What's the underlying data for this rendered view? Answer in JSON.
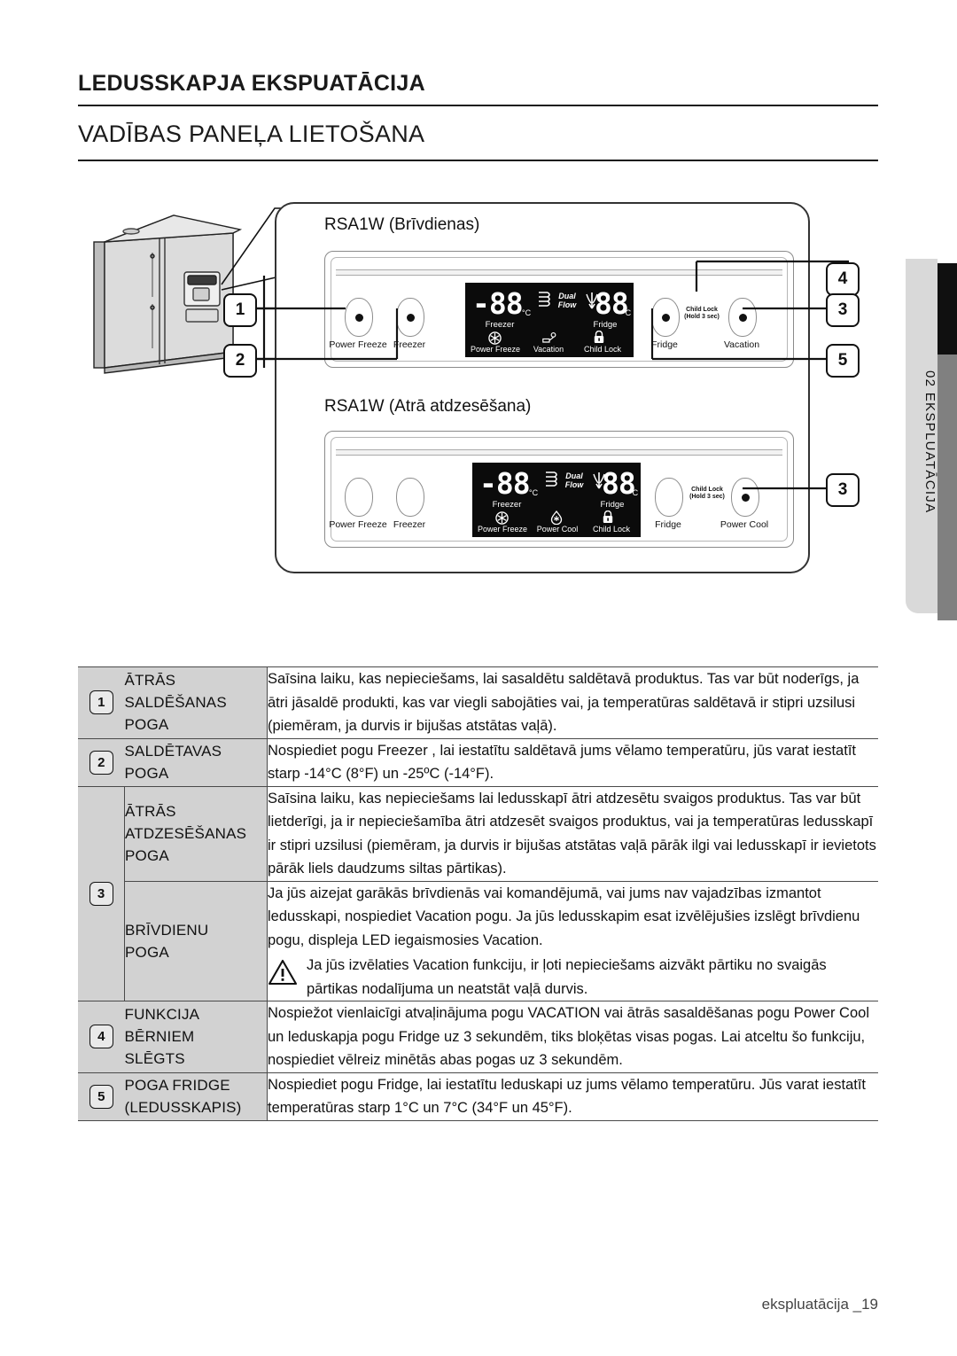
{
  "headings": {
    "title": "LEDUSSKAPJA EKSPUATĀCIJA",
    "subtitle": "VADĪBAS PANEĻA LIETOŠANA"
  },
  "side_tab": {
    "label": "02 EKSPLUATĀCIJA"
  },
  "footer": {
    "text": "ekspluatācija _19"
  },
  "diagram": {
    "panels": [
      {
        "caption": "RSA1W (Brīvdienas)",
        "buttons_left": [
          {
            "label": "Power Freeze",
            "has_dot": true
          },
          {
            "label": "Freezer",
            "has_dot": true
          }
        ],
        "buttons_right": [
          {
            "label": "Fridge",
            "has_dot": true
          },
          {
            "label": "Vacation",
            "has_dot": true
          }
        ],
        "child_lock_hint": {
          "line1": "Child Lock",
          "line2": "(Hold 3 sec)"
        },
        "display": {
          "left_value": "-88",
          "left_unit": "°C",
          "left_label": "Freezer",
          "right_value": "88",
          "right_unit": "°C",
          "right_label": "Fridge",
          "center_badge_line1": "Dual",
          "center_badge_line2": "Flow",
          "indicators": [
            {
              "icon": "snowflake-icon",
              "label": "Power Freeze"
            },
            {
              "icon": "vacation-icon",
              "label": "Vacation"
            },
            {
              "icon": "lock-icon",
              "label": "Child Lock"
            }
          ]
        }
      },
      {
        "caption": "RSA1W (Atrā atdzesēšana)",
        "buttons_left": [
          {
            "label": "Power Freeze",
            "has_dot": false
          },
          {
            "label": "Freezer",
            "has_dot": false
          }
        ],
        "buttons_right": [
          {
            "label": "Fridge",
            "has_dot": false
          },
          {
            "label": "Power Cool",
            "has_dot": true
          }
        ],
        "child_lock_hint": {
          "line1": "Child Lock",
          "line2": "(Hold 3 sec)"
        },
        "display": {
          "left_value": "-88",
          "left_unit": "°C",
          "left_label": "Freezer",
          "right_value": "88",
          "right_unit": "°C",
          "right_label": "Fridge",
          "center_badge_line1": "Dual",
          "center_badge_line2": "Flow",
          "indicators": [
            {
              "icon": "snowflake-icon",
              "label": "Power Freeze"
            },
            {
              "icon": "droplet-icon",
              "label": "Power Cool"
            },
            {
              "icon": "lock-icon",
              "label": "Child Lock"
            }
          ]
        }
      }
    ],
    "callouts": [
      "1",
      "2",
      "4",
      "3",
      "5",
      "3"
    ]
  },
  "table": {
    "rows": [
      {
        "number": "1",
        "name": "ĀTRĀS\nSALDĒŠANAS\nPOGA",
        "desc": "Saīsina laiku, kas nepieciešams, lai sasaldētu saldētavā produktus. Tas var būt noderīgs, ja ātri jāsaldē produkti, kas var viegli sabojāties vai, ja temperatūras saldētavā ir stipri uzsilusi (piemēram, ja durvis ir bijušas atstātas vaļā)."
      },
      {
        "number": "2",
        "name": "SALDĒTAVAS\nPOGA",
        "desc": "Nospiediet pogu Freezer , lai iestatītu saldētavā jums vēlamo temperatūru, jūs varat iestatīt starp -14°C (8°F) un -25ºC (-14°F)."
      },
      {
        "number": "3",
        "name": "ĀTRĀS\nATDZESĒŠANAS\nPOGA",
        "desc": "Saīsina laiku, kas nepieciešams lai ledusskapī ātri atdzesētu svaigos produktus. Tas var būt lietderīgi, ja ir nepieciešamība ātri atdzesēt svaigos produktus, vai ja temperatūras ledusskapī ir stipri uzsilusi (piemēram, ja durvis ir bijušas atstātas vaļā pārāk ilgi vai ledusskapī ir ievietots pārāk liels daudzums siltas pārtikas)."
      },
      {
        "number": "",
        "name": "BRĪVDIENU\nPOGA",
        "desc": "Ja jūs aizejat garākās brīvdienās vai komandējumā, vai jums nav vajadzības izmantot ledusskapi, nospiediet Vacation pogu. Ja jūs ledusskapim esat izvēlējušies izslēgt brīvdienu pogu, displeja LED iegaismosies Vacation.",
        "warning": "Ja jūs izvēlaties Vacation funkciju, ir ļoti nepieciešams aizvākt pārtiku no svaigās pārtikas nodalījuma un neatstāt vaļā durvis."
      },
      {
        "number": "4",
        "name": "FUNKCIJA\nBĒRNIEM\nSLĒGTS",
        "desc": "Nospiežot vienlaicīgi atvaļinājuma pogu VACATION vai ātrās sasaldēšanas pogu Power Cool un leduskapja pogu Fridge uz 3 sekundēm, tiks bloķētas visas pogas. Lai atceltu šo funkciju, nospiediet vēlreiz minētās abas pogas uz 3 sekundēm."
      },
      {
        "number": "5",
        "name": "POGA FRIDGE\n(LEDUSSKAPIS)",
        "desc": "Nospiediet pogu Fridge, lai iestatītu leduskapi uz jums vēlamo temperatūru. Jūs varat iestatīt temperatūras starp 1°C un 7°C (34°F un 45°F)."
      }
    ]
  },
  "colors": {
    "ink": "#1a1a1a",
    "table_header_bg": "#d2d2d2",
    "lcd_bg": "#0b0b0b",
    "tab_black": "#101010",
    "tab_gray": "#808080",
    "tab_light": "#d9d9d9"
  }
}
